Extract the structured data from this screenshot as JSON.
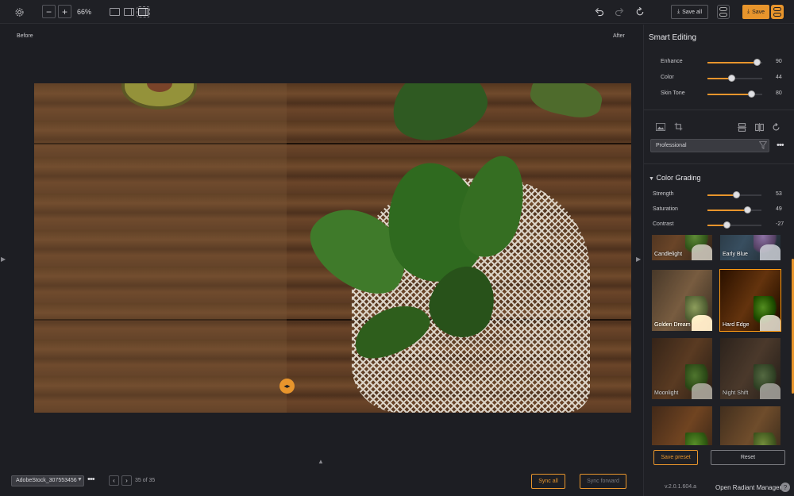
{
  "toolbar": {
    "zoom_minus": "−",
    "zoom_plus": "+",
    "zoom_level": "66%",
    "save_all_label": "Save all",
    "save_label": "Save",
    "settings_icon": "gear-icon",
    "undo_icon": "undo-icon",
    "redo_icon": "redo-icon",
    "reset_icon": "refresh-icon"
  },
  "canvas": {
    "before_label": "Before",
    "after_label": "After"
  },
  "bottombar": {
    "file_name": "AdobeStock_307553456",
    "counter": "35 of 35",
    "sync_all": "Sync all",
    "sync_forward": "Sync forward"
  },
  "panel": {
    "title": "Smart Editing",
    "smart_sliders": [
      {
        "label": "Enhance",
        "value": 90,
        "display": "90"
      },
      {
        "label": "Color",
        "value": 44,
        "display": "44"
      },
      {
        "label": "Skin Tone",
        "value": 80,
        "display": "80"
      }
    ],
    "preset_select": "Professional",
    "section_title": "Color Grading",
    "grading_sliders": [
      {
        "label": "Strength",
        "value": 53,
        "display": "53",
        "min": 0,
        "max": 100
      },
      {
        "label": "Saturation",
        "value": 49,
        "display": "49",
        "min": -100,
        "max": 100
      },
      {
        "label": "Contrast",
        "value": -27,
        "display": "-27",
        "min": -100,
        "max": 100
      }
    ],
    "presets": [
      {
        "label": "Candlelight"
      },
      {
        "label": "Early Blue"
      },
      {
        "label": "Golden Dream"
      },
      {
        "label": "Hard Edge",
        "selected": true
      },
      {
        "label": "Moonlight"
      },
      {
        "label": "Night Shift"
      },
      {
        "label": ""
      },
      {
        "label": ""
      }
    ],
    "save_preset": "Save preset",
    "reset": "Reset",
    "version": "v.2.0.1.604.a",
    "manager": "Open Radiant Manager",
    "help": "?"
  },
  "colors": {
    "accent": "#e8952c",
    "background": "#1d1e23",
    "panel": "#1f2025"
  }
}
